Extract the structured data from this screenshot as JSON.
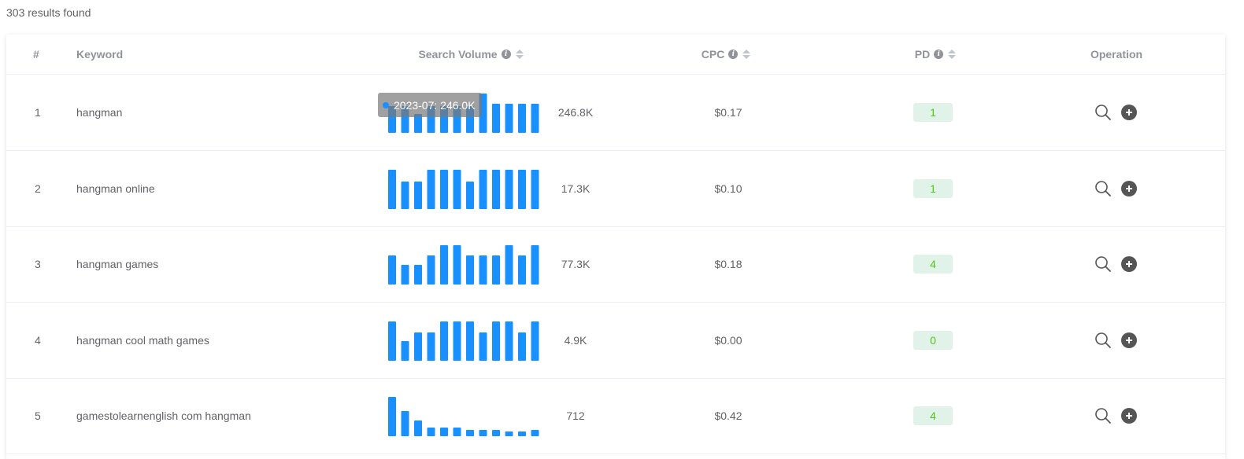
{
  "results_count": "303 results found",
  "columns": {
    "index": "#",
    "keyword": "Keyword",
    "search_volume": "Search Volume",
    "cpc": "CPC",
    "pd": "PD",
    "operation": "Operation"
  },
  "colors": {
    "bar": "#1890ff",
    "pd_bg": "#e1f3e8",
    "pd_text": "#52c41a"
  },
  "rows": [
    {
      "index": "1",
      "keyword": "hangman",
      "volume": "246.8K",
      "cpc": "$0.17",
      "pd": "1",
      "trend": [
        0.68,
        0.68,
        0.48,
        0.68,
        0.68,
        0.68,
        0.68,
        1.0,
        0.74,
        0.74,
        0.74,
        0.74
      ]
    },
    {
      "index": "2",
      "keyword": "hangman online",
      "volume": "17.3K",
      "cpc": "$0.10",
      "pd": "1",
      "trend": [
        1.0,
        0.7,
        0.7,
        1.0,
        1.0,
        1.0,
        0.7,
        1.0,
        1.0,
        1.0,
        1.0,
        1.0
      ]
    },
    {
      "index": "3",
      "keyword": "hangman games",
      "volume": "77.3K",
      "cpc": "$0.18",
      "pd": "4",
      "trend": [
        0.74,
        0.5,
        0.5,
        0.74,
        1.0,
        1.0,
        0.74,
        0.74,
        0.74,
        1.0,
        0.74,
        1.0
      ]
    },
    {
      "index": "4",
      "keyword": "hangman cool math games",
      "volume": "4.9K",
      "cpc": "$0.00",
      "pd": "0",
      "trend": [
        1.0,
        0.5,
        0.72,
        0.72,
        1.0,
        1.0,
        1.0,
        0.72,
        1.0,
        1.0,
        0.72,
        1.0
      ]
    },
    {
      "index": "5",
      "keyword": "gamestolearnenglish com hangman",
      "volume": "712",
      "cpc": "$0.42",
      "pd": "4",
      "trend": [
        1.0,
        0.64,
        0.4,
        0.22,
        0.22,
        0.22,
        0.16,
        0.16,
        0.16,
        0.12,
        0.12,
        0.16
      ]
    }
  ],
  "tooltip": {
    "text": "2023-07: 246.0K"
  }
}
